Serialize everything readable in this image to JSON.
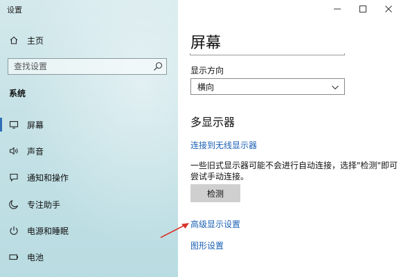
{
  "window": {
    "title": "设置"
  },
  "sidebar": {
    "items_top": [
      {
        "label": "主页",
        "icon": "home-icon"
      }
    ],
    "search": {
      "placeholder": "查找设置",
      "icon": "search-icon"
    },
    "section_heading": "系统",
    "items": [
      {
        "label": "屏幕",
        "icon": "display-icon",
        "active": true
      },
      {
        "label": "声音",
        "icon": "speaker-icon"
      },
      {
        "label": "通知和操作",
        "icon": "notification-icon"
      },
      {
        "label": "专注助手",
        "icon": "moon-icon"
      },
      {
        "label": "电源和睡眠",
        "icon": "power-icon"
      },
      {
        "label": "电池",
        "icon": "battery-icon"
      }
    ]
  },
  "main": {
    "title": "屏幕",
    "orientation": {
      "label": "显示方向",
      "value": "横向"
    },
    "multi_display": {
      "heading": "多显示器",
      "wireless_link": "连接到无线显示器",
      "description": "一些旧式显示器可能不会进行自动连接，选择\"检测\"即可尝试手动连接。",
      "detect_button": "检测",
      "advanced_link": "高级显示设置",
      "graphics_link": "图形设置"
    }
  },
  "colors": {
    "accent": "#2f6fb8",
    "link": "#1a5fb4",
    "annotation_arrow": "#d9342b"
  }
}
